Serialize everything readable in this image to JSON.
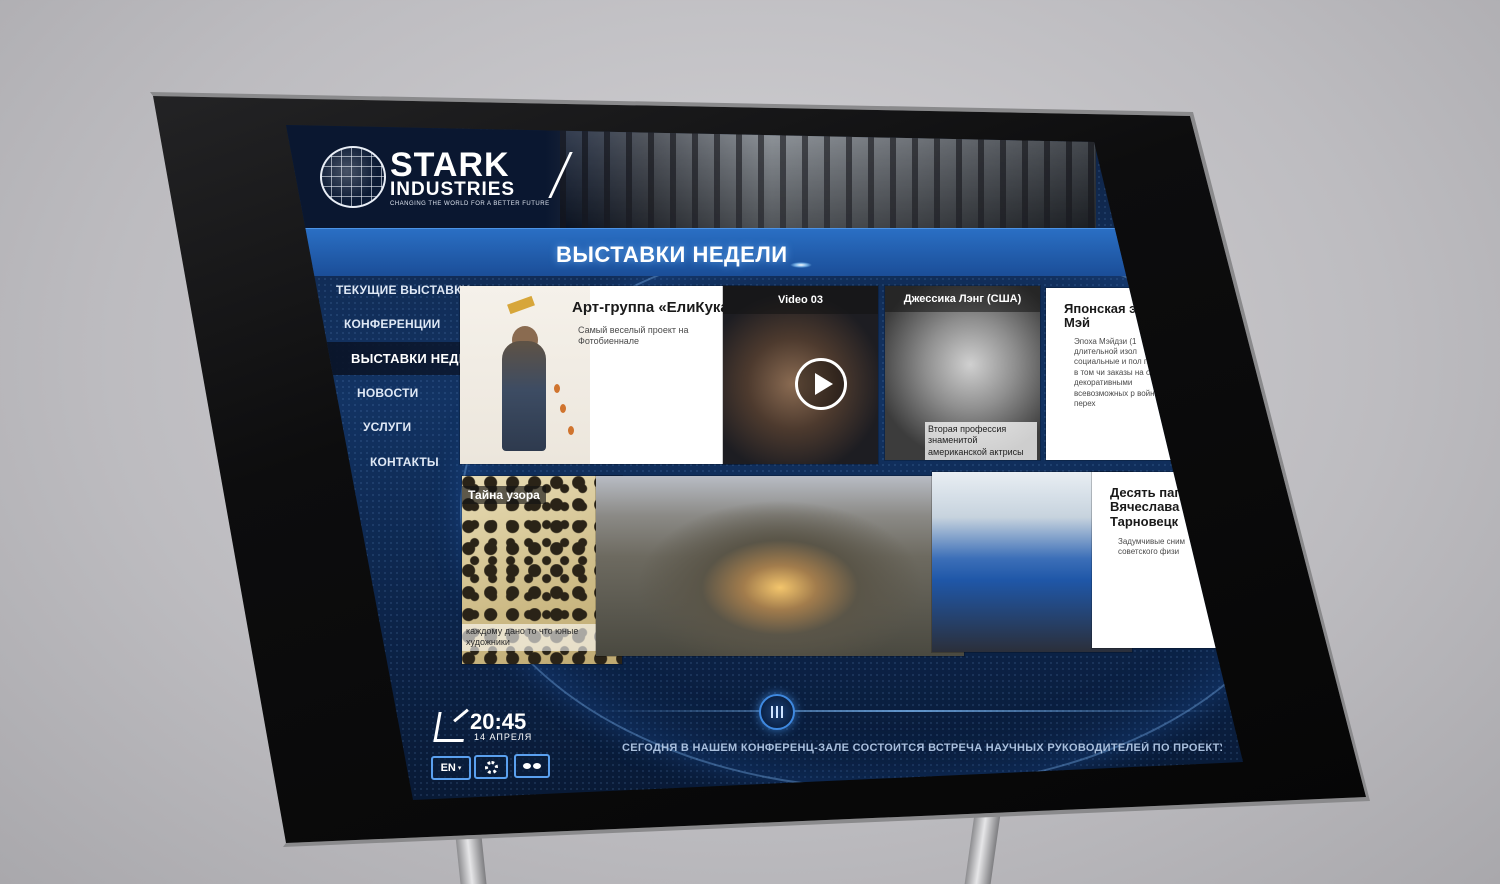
{
  "brand": {
    "name_line1": "STARK",
    "name_line2": "INDUSTRIES",
    "tagline": "CHANGING THE WORLD FOR A BETTER FUTURE"
  },
  "page_title": "ВЫСТАВКИ НЕДЕЛИ",
  "nav": {
    "items": [
      {
        "label": "ТЕКУЩИЕ ВЫСТАВКИ"
      },
      {
        "label": "КОНФЕРЕНЦИИ"
      },
      {
        "label": "ВЫСТАВКИ НЕДЕЛИ"
      },
      {
        "label": "НОВОСТИ"
      },
      {
        "label": "УСЛУГИ"
      },
      {
        "label": "КОНТАКТЫ"
      }
    ],
    "active": "ВЫСТАВКИ НЕДЕЛИ"
  },
  "tiles": {
    "art_group": {
      "title": "Арт-группа «ЕлиКука»",
      "subtitle": "Самый веселый проект на Фотобиеннале"
    },
    "video": {
      "header": "Video 03"
    },
    "jessica": {
      "header": "Джессика Лэнг (США)",
      "caption": "Вторая профессия знаменитой американской актрисы"
    },
    "japan": {
      "title": "Японская эпохи Мэй",
      "subtitle": "Эпоха Мэйдзи (1 длительной изол социальные и пол привели в том чи заказы на оруж декоративными всевозможных р войнами и перех"
    },
    "pattern": {
      "header": "Тайна узора",
      "caption": "каждому дано то что юные художники"
    },
    "ten": {
      "title": "Десять пап Вячеслава Тарновецк",
      "subtitle": "Задумчивые сним советского физи"
    }
  },
  "ticker": "СЕГОДНЯ В НАШЕМ КОНФЕРЕНЦ-ЗАЛЕ СОСТОИТСЯ ВСТРЕЧА НАУЧНЫХ РУКОВОДИТЕЛЕЙ ПО ПРОЕКТУ",
  "clock": {
    "time": "20:45",
    "date": "14 АПРЕЛЯ"
  },
  "controls": {
    "language": "EN"
  },
  "icons": {
    "play": "play-icon",
    "scroll": "scroll-knob-icon",
    "gear": "gear-icon",
    "glasses": "glasses-icon",
    "clock": "clock-icon"
  },
  "colors": {
    "accent_blue": "#2a6fc4",
    "screen_dark": "#0b2144",
    "button_border": "#5aa0ef"
  }
}
